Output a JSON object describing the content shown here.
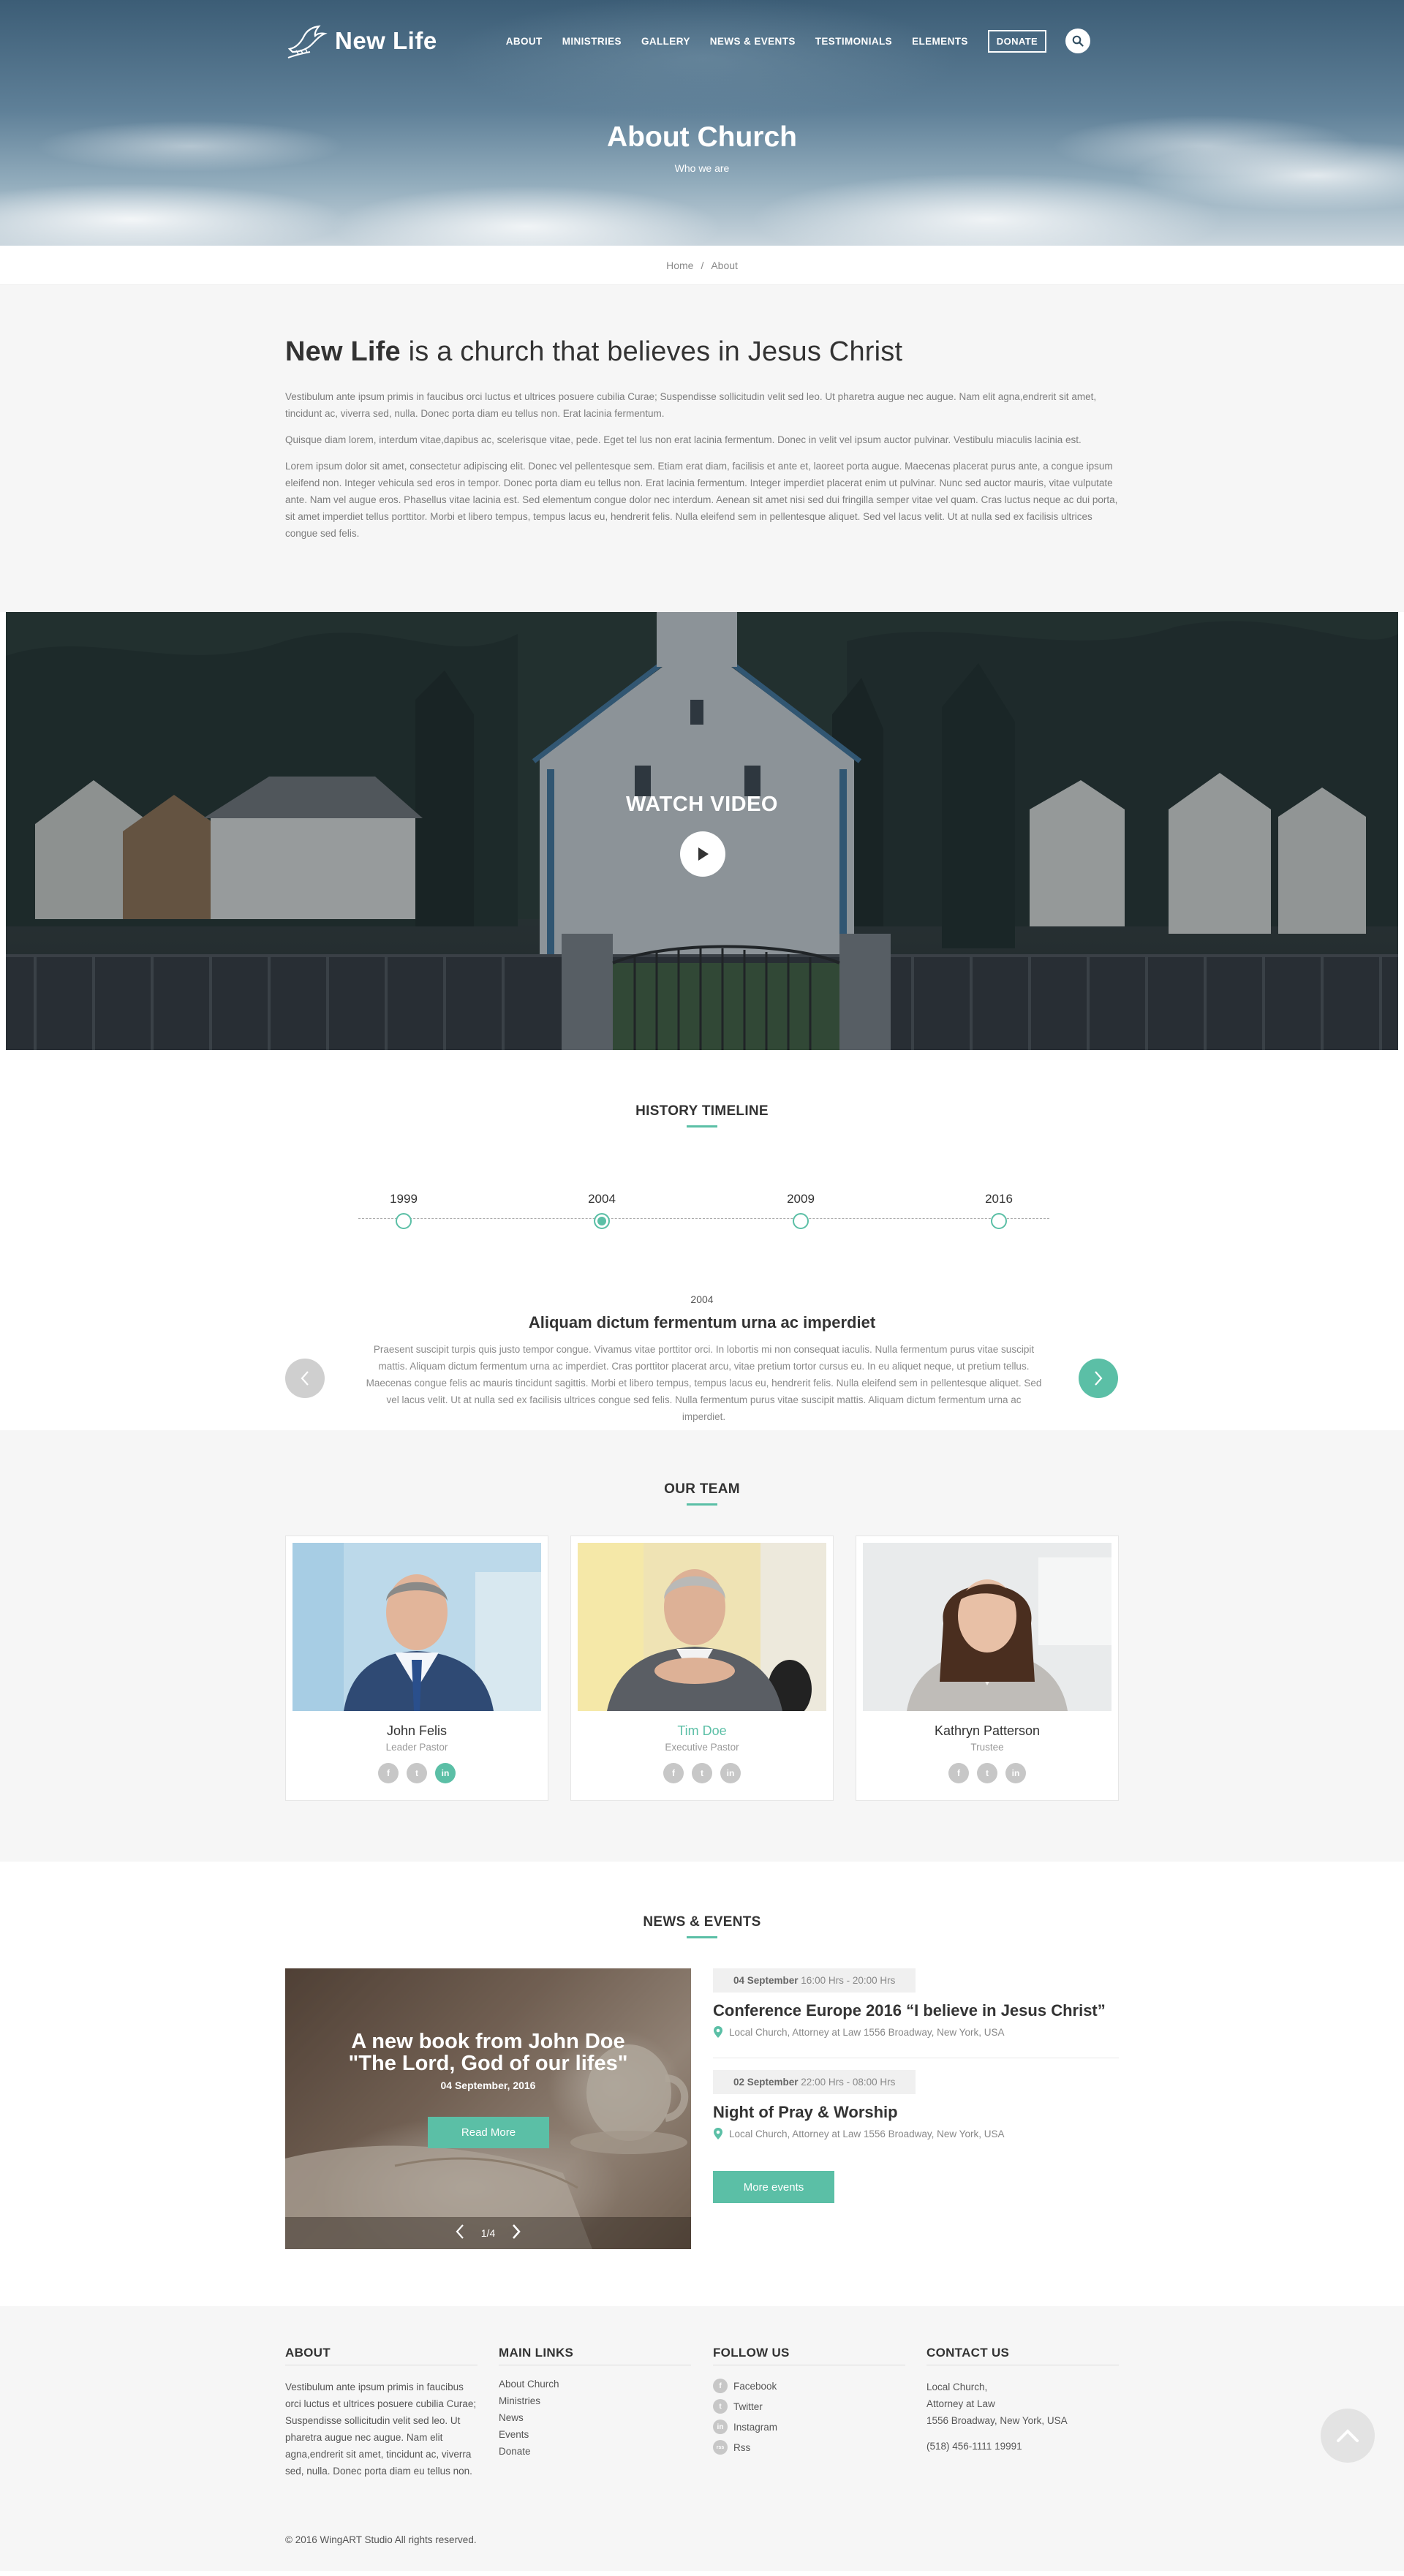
{
  "brand": {
    "name": "New Life"
  },
  "nav": {
    "items": [
      "ABOUT",
      "MINISTRIES",
      "GALLERY",
      "NEWS & EVENTS",
      "TESTIMONIALS",
      "ELEMENTS"
    ],
    "donate": "DONATE",
    "search_icon": "search-icon"
  },
  "hero": {
    "title": "About Church",
    "subtitle": "Who we are"
  },
  "breadcrumb": {
    "home": "Home",
    "separator": "/",
    "current": "About"
  },
  "about": {
    "heading_brand": "New Life",
    "heading_rest": " is a church that believes in Jesus Christ",
    "paragraphs": [
      "Vestibulum ante ipsum primis in faucibus orci luctus et ultrices posuere cubilia Curae; Suspendisse sollicitudin velit sed leo. Ut pharetra augue nec augue. Nam elit agna,endrerit sit amet, tincidunt ac, viverra sed, nulla. Donec porta diam eu tellus non. Erat lacinia fermentum.",
      "Quisque diam lorem, interdum vitae,dapibus ac, scelerisque vitae, pede. Eget tel lus non erat lacinia fermentum. Donec in velit vel ipsum auctor pulvinar. Vestibulu miaculis lacinia est.",
      "Lorem ipsum dolor sit amet, consectetur adipiscing elit. Donec vel pellentesque sem. Etiam erat diam, facilisis et ante et, laoreet porta augue. Maecenas placerat purus ante, a congue ipsum eleifend non. Integer vehicula sed eros in tempor.  Donec porta diam eu tellus non. Erat lacinia fermentum. Integer imperdiet placerat enim ut pulvinar. Nunc sed auctor mauris, vitae vulputate ante. Nam vel augue eros. Phasellus vitae lacinia est. Sed elementum congue dolor nec interdum. Aenean sit amet nisi sed dui fringilla semper vitae vel quam. Cras luctus neque ac dui porta, sit amet imperdiet tellus porttitor. Morbi et libero tempus, tempus lacus eu, hendrerit felis. Nulla eleifend sem in pellentesque aliquet. Sed vel lacus velit. Ut at nulla sed ex facilisis ultrices congue sed felis."
    ]
  },
  "video": {
    "title": "WATCH VIDEO",
    "play_icon": "play-icon"
  },
  "timeline": {
    "title": "HISTORY TIMELINE",
    "years": [
      "1999",
      "2004",
      "2009",
      "2016"
    ],
    "active_year": "2004",
    "entry": {
      "date": "2004",
      "heading": "Aliquam dictum fermentum urna ac imperdiet",
      "text": "Praesent suscipit turpis quis justo tempor congue. Vivamus vitae porttitor orci. In lobortis mi non consequat iaculis. Nulla fermentum purus vitae suscipit mattis.  Aliquam dictum fermentum urna ac imperdiet. Cras porttitor placerat arcu, vitae pretium tortor cursus eu. In eu aliquet neque, ut pretium tellus. Maecenas congue felis ac mauris tincidunt sagittis. Morbi et libero tempus, tempus lacus eu, hendrerit felis. Nulla eleifend sem in pellentesque aliquet. Sed vel lacus velit. Ut at nulla sed ex facilisis ultrices congue sed felis. Nulla fermentum purus vitae suscipit mattis.  Aliquam dictum fermentum urna ac imperdiet."
    }
  },
  "team": {
    "title": "OUR TEAM",
    "members": [
      {
        "name": "John Felis",
        "role": "Leader Pastor"
      },
      {
        "name": "Tim Doe",
        "role": "Executive Pastor"
      },
      {
        "name": "Kathryn Patterson",
        "role": "Trustee"
      }
    ],
    "social_labels": [
      "f",
      "t",
      "in"
    ]
  },
  "news": {
    "title": "NEWS & EVENTS",
    "slide": {
      "title_line1": "A new book from John Doe",
      "title_line2": "\"The Lord, God of our lifes\"",
      "date": "04 September, 2016",
      "button": "Read More",
      "counter": "1/4"
    },
    "events": [
      {
        "date_day": "04 September",
        "time": " 16:00 Hrs - 20:00 Hrs",
        "title": "Conference Europe 2016 “I believe in Jesus Christ”",
        "location": "Local Church, Attorney at Law 1556 Broadway,  New York, USA"
      },
      {
        "date_day": "02 September",
        "time": " 22:00 Hrs - 08:00 Hrs",
        "title": "Night of Pray & Worship",
        "location": "Local Church, Attorney at Law 1556 Broadway,  New York, USA"
      }
    ],
    "more_button": "More events"
  },
  "footer": {
    "about": {
      "title": "ABOUT",
      "text": "Vestibulum ante ipsum primis in faucibus orci luctus et ultrices posuere cubilia Curae; Suspendisse sollicitudin velit sed leo. Ut pharetra augue nec augue. Nam elit agna,endrerit sit amet, tincidunt ac, viverra sed, nulla. Donec porta diam eu tellus non."
    },
    "links": {
      "title": "MAIN LINKS",
      "items": [
        "About Church",
        "Ministries",
        "News",
        "Events",
        "Donate"
      ]
    },
    "follow": {
      "title": "FOLLOW US",
      "items": [
        "Facebook",
        "Twitter",
        "Instagram",
        "Rss"
      ],
      "icons": [
        "f",
        "t",
        "in",
        "rss"
      ]
    },
    "contact": {
      "title": "CONTACT US",
      "line1": "Local Church,",
      "line2": "Attorney at Law",
      "line3": "1556 Broadway,  New York, USA",
      "phone": "(518) 456-1111 19991"
    },
    "copyright": "© 2016  WingART Studio  All rights reserved."
  },
  "colors": {
    "accent": "#5bbfa6",
    "dark_text": "#333333",
    "muted_text": "#7d7d7d",
    "section_bg": "#f6f6f6"
  }
}
